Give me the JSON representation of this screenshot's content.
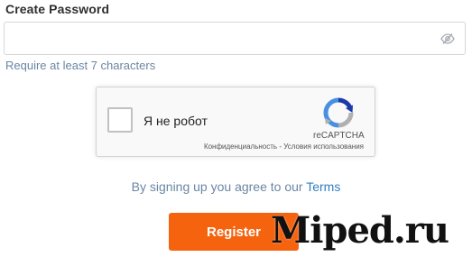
{
  "password": {
    "label": "Create Password",
    "value": "",
    "placeholder": "",
    "toggle_icon": "eye-slash-icon",
    "hint": "Require at least 7 characters"
  },
  "recaptcha": {
    "label": "Я не робот",
    "brand": "reCAPTCHA",
    "privacy": "Конфиденциальность",
    "separator": " - ",
    "terms": "Условия использования",
    "logo_icon": "recaptcha-logo-icon"
  },
  "agreement": {
    "text": "By signing up you agree to our ",
    "link": "Terms"
  },
  "register": {
    "label": "Register"
  },
  "watermark": {
    "text": "Miped.ru"
  },
  "colors": {
    "accent": "#f5630f",
    "link": "#2f7fc1",
    "hint": "#6a86a3"
  }
}
